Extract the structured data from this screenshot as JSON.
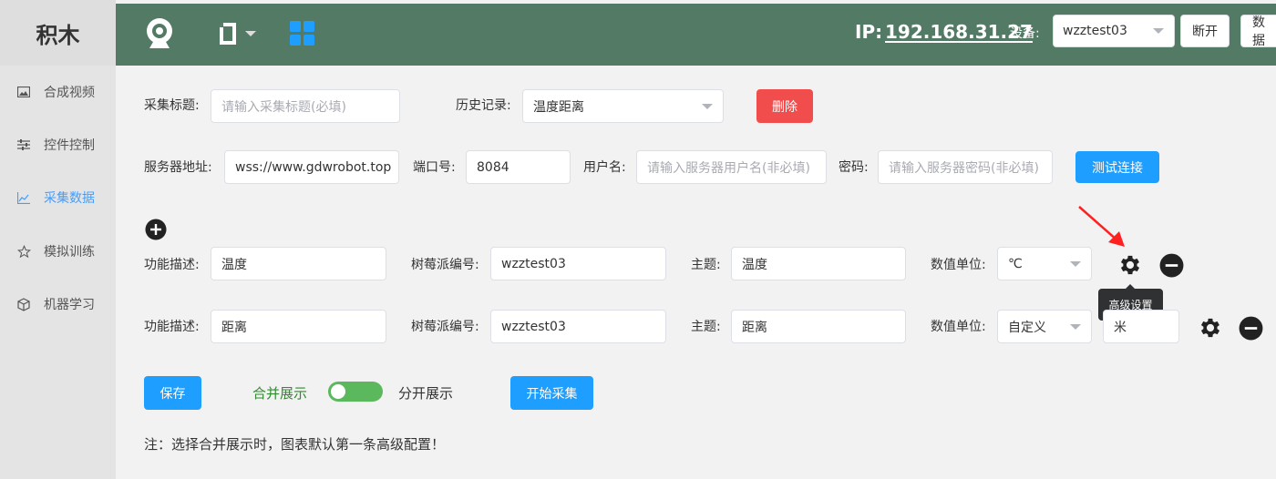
{
  "sidebar": {
    "logo": "积木",
    "items": [
      {
        "label": "合成视频"
      },
      {
        "label": "控件控制"
      },
      {
        "label": "采集数据"
      },
      {
        "label": "模拟训练"
      },
      {
        "label": "机器学习"
      }
    ]
  },
  "header": {
    "ip_label": "IP:",
    "ip_value": "192.168.31.27",
    "device_label": "设备:",
    "device_value": "wzztest03",
    "disconnect": "断开",
    "data_btn": "数据"
  },
  "form": {
    "title_label": "采集标题:",
    "title_placeholder": "请输入采集标题(必填)",
    "history_label": "历史记录:",
    "history_value": "温度距离",
    "delete": "删除",
    "server_label": "服务器地址:",
    "server_value": "wss://www.gdwrobot.top",
    "port_label": "端口号:",
    "port_value": "8084",
    "user_label": "用户名:",
    "user_placeholder": "请输入服务器用户名(非必填)",
    "pwd_label": "密码:",
    "pwd_placeholder": "请输入服务器密码(非必填)",
    "test_connect": "测试连接"
  },
  "rows": [
    {
      "func_label": "功能描述:",
      "func_value": "温度",
      "pi_label": "树莓派编号:",
      "pi_value": "wzztest03",
      "topic_label": "主题:",
      "topic_value": "温度",
      "unit_label": "数值单位:",
      "unit_value": "℃"
    },
    {
      "func_label": "功能描述:",
      "func_value": "距离",
      "pi_label": "树莓派编号:",
      "pi_value": "wzztest03",
      "topic_label": "主题:",
      "topic_value": "距离",
      "unit_label": "数值单位:",
      "unit_value": "自定义",
      "custom_unit": "米"
    }
  ],
  "tooltip": "高级设置",
  "footer": {
    "save": "保存",
    "merge_label": "合并展示",
    "split_label": "分开展示",
    "start": "开始采集",
    "note": "注：选择合并展示时，图表默认第一条高级配置！"
  },
  "colors": {
    "header_bg": "#527a64",
    "accent_blue": "#1e9fff",
    "danger_red": "#f24d4d",
    "toggle_green": "#5cb85c",
    "merge_text_green": "#2e8b2e",
    "active_nav": "#409eff"
  }
}
